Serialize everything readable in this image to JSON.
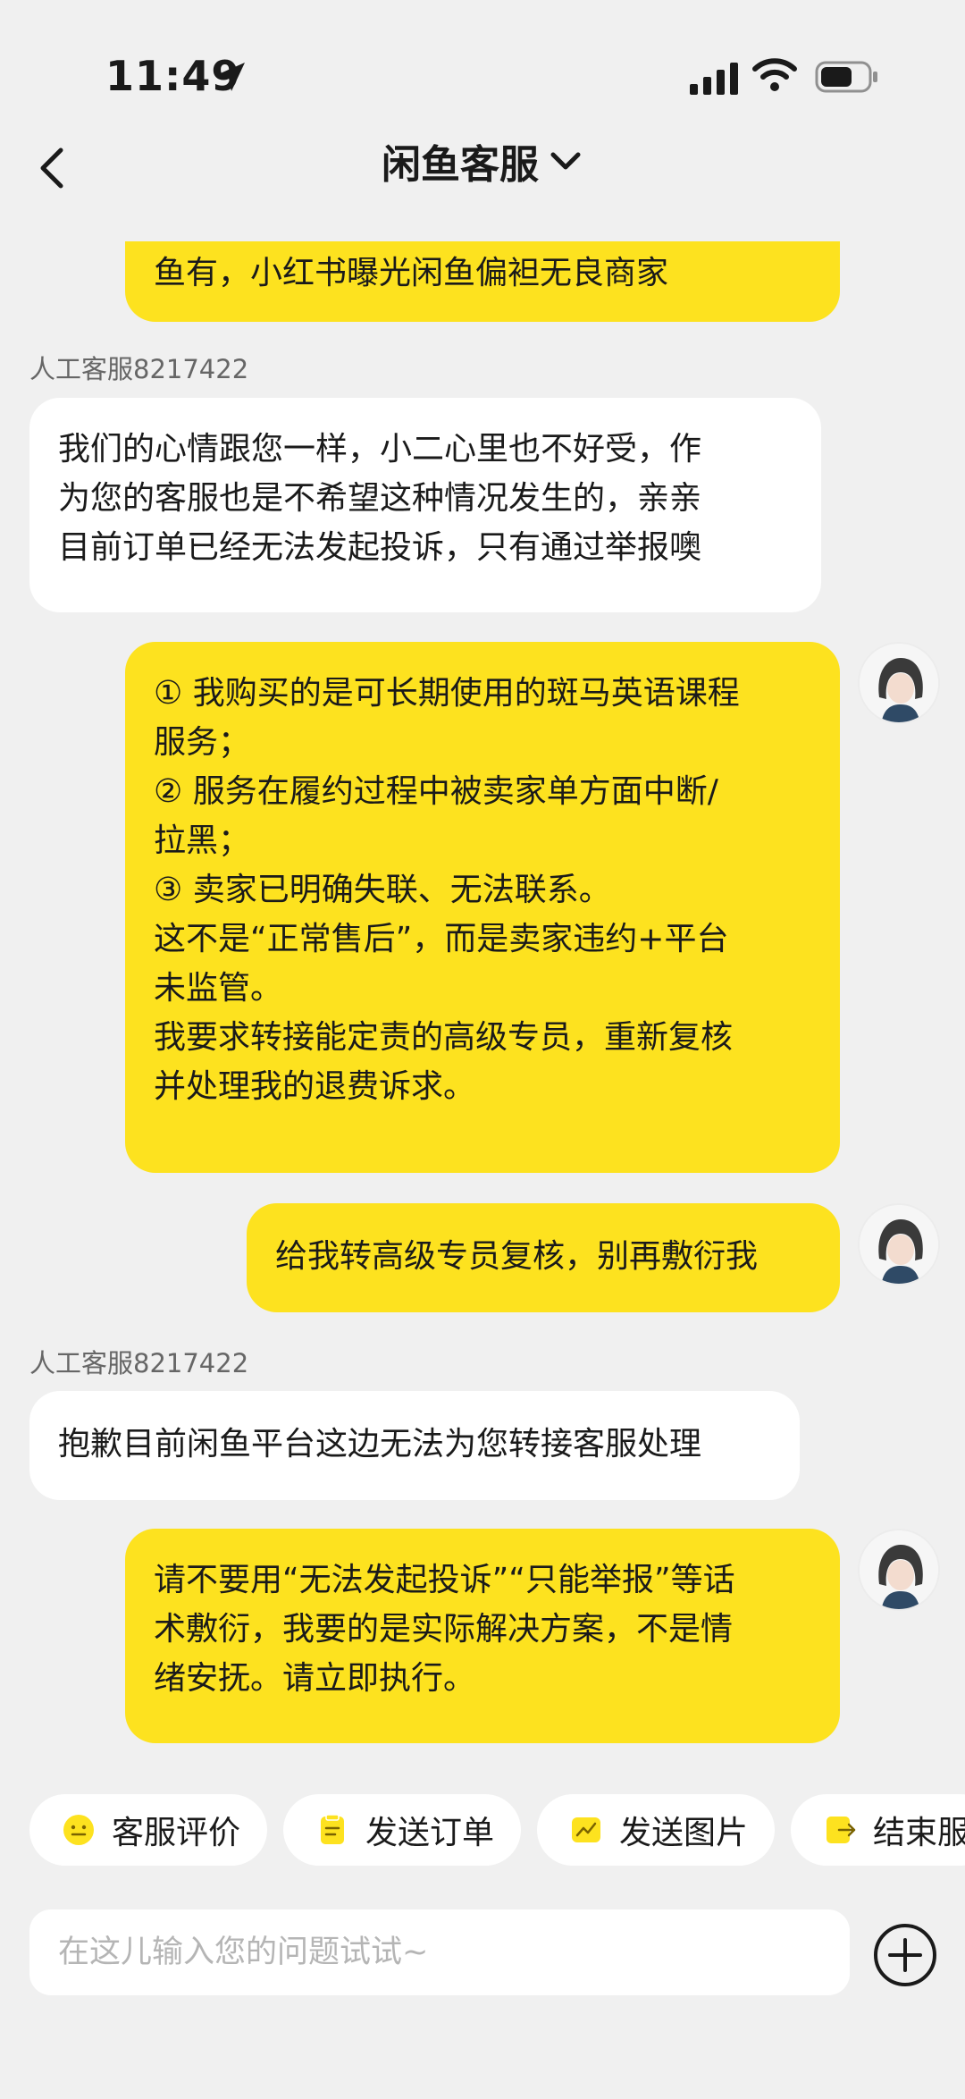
{
  "status_bar": {
    "time": "11:49"
  },
  "nav": {
    "title": "闲鱼客服"
  },
  "messages": [
    {
      "from": "me",
      "lines": [
        "鱼有，小红书曝光闲鱼偏袒无良商家"
      ]
    },
    {
      "from": "agent",
      "sender": "人工客服8217422",
      "lines": [
        "我们的心情跟您一样，小二心里也不好受，作",
        "为您的客服也是不希望这种情况发生的，亲亲",
        "目前订单已经无法发起投诉，只有通过举报噢"
      ]
    },
    {
      "from": "me",
      "lines": [
        "① 我购买的是可长期使用的斑马英语课程",
        "服务；",
        "② 服务在履约过程中被卖家单方面中断/",
        "拉黑；",
        "③ 卖家已明确失联、无法联系。",
        "这不是“正常售后”，而是卖家违约+平台",
        "未监管。",
        "我要求转接能定责的高级专员，重新复核",
        "并处理我的退费诉求。"
      ]
    },
    {
      "from": "me",
      "lines": [
        "给我转高级专员复核，别再敷衍我"
      ]
    },
    {
      "from": "agent",
      "sender": "人工客服8217422",
      "lines": [
        "抱歉目前闲鱼平台这边无法为您转接客服处理"
      ]
    },
    {
      "from": "me",
      "lines": [
        "请不要用“无法发起投诉”“只能举报”等话",
        "术敷衍，我要的是实际解决方案，不是情",
        "绪安抚。请立即执行。"
      ]
    }
  ],
  "quick_actions": [
    {
      "label": "客服评价",
      "icon": "face-icon"
    },
    {
      "label": "发送订单",
      "icon": "order-icon"
    },
    {
      "label": "发送图片",
      "icon": "image-icon"
    },
    {
      "label": "结束服",
      "icon": "exit-icon"
    }
  ],
  "input": {
    "placeholder": "在这儿输入您的问题试试~"
  },
  "colors": {
    "accent": "#fde21f",
    "background": "#f0f0f0",
    "agent_bubble": "#ffffff"
  }
}
